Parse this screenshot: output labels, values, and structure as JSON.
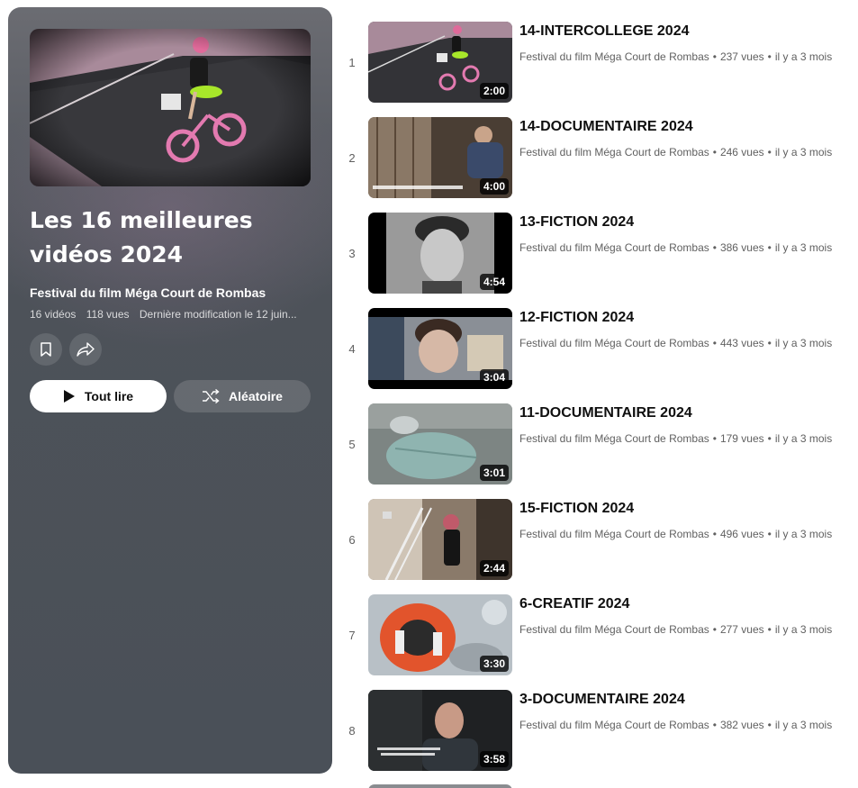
{
  "playlist": {
    "title": "Les 16 meilleures vidéos 2024",
    "channel": "Festival du film Méga Court de Rombas",
    "video_count": "16 vidéos",
    "views": "118 vues",
    "last_modified": "Dernière modification le 12 juin...",
    "save_icon": "bookmark-icon",
    "share_icon": "share-icon",
    "play_all_label": "Tout lire",
    "shuffle_label": "Aléatoire"
  },
  "videos": [
    {
      "index": "1",
      "title": "14-INTERCOLLEGE 2024",
      "channel": "Festival du film Méga Court de Rombas",
      "views": "237 vues",
      "age": "il y a 3 mois",
      "duration": "2:00"
    },
    {
      "index": "2",
      "title": "14-DOCUMENTAIRE 2024",
      "channel": "Festival du film Méga Court de Rombas",
      "views": "246 vues",
      "age": "il y a 3 mois",
      "duration": "4:00"
    },
    {
      "index": "3",
      "title": "13-FICTION 2024",
      "channel": "Festival du film Méga Court de Rombas",
      "views": "386 vues",
      "age": "il y a 3 mois",
      "duration": "4:54"
    },
    {
      "index": "4",
      "title": "12-FICTION 2024",
      "channel": "Festival du film Méga Court de Rombas",
      "views": "443 vues",
      "age": "il y a 3 mois",
      "duration": "3:04"
    },
    {
      "index": "5",
      "title": "11-DOCUMENTAIRE 2024",
      "channel": "Festival du film Méga Court de Rombas",
      "views": "179 vues",
      "age": "il y a 3 mois",
      "duration": "3:01"
    },
    {
      "index": "6",
      "title": "15-FICTION 2024",
      "channel": "Festival du film Méga Court de Rombas",
      "views": "496 vues",
      "age": "il y a 3 mois",
      "duration": "2:44"
    },
    {
      "index": "7",
      "title": "6-CREATIF 2024",
      "channel": "Festival du film Méga Court de Rombas",
      "views": "277 vues",
      "age": "il y a 3 mois",
      "duration": "3:30"
    },
    {
      "index": "8",
      "title": "3-DOCUMENTAIRE 2024",
      "channel": "Festival du film Méga Court de Rombas",
      "views": "382 vues",
      "age": "il y a 3 mois",
      "duration": "3:58"
    }
  ]
}
